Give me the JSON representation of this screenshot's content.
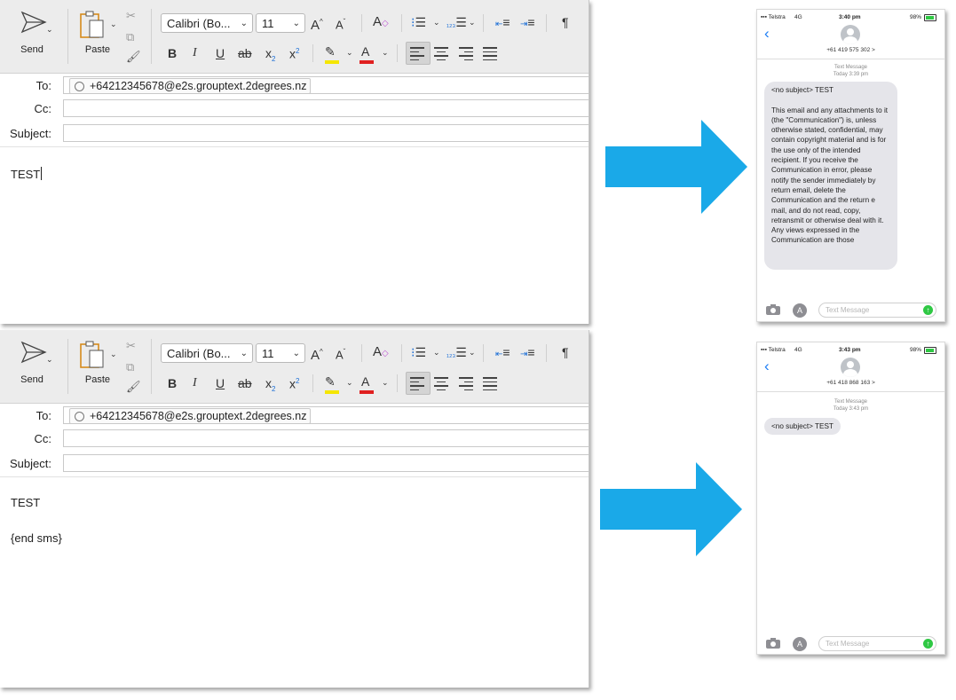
{
  "compose_windows": [
    {
      "send_label": "Send",
      "paste_label": "Paste",
      "font_name": "Calibri (Bo...",
      "font_size": "11",
      "pilcrow": "¶",
      "to_label": "To:",
      "to_recipient": "+64212345678@e2s.grouptext.2degrees.nz",
      "cc_label": "Cc:",
      "subject_label": "Subject:",
      "body_lines": [
        "TEST"
      ]
    },
    {
      "send_label": "Send",
      "paste_label": "Paste",
      "font_name": "Calibri (Bo...",
      "font_size": "11",
      "pilcrow": "¶",
      "to_label": "To:",
      "to_recipient": "+64212345678@e2s.grouptext.2degrees.nz",
      "cc_label": "Cc:",
      "subject_label": "Subject:",
      "body_lines": [
        "TEST",
        "{end sms}"
      ]
    }
  ],
  "phones": [
    {
      "carrier": "Telstra",
      "network": "4G",
      "time": "3:40 pm",
      "battery": "98%",
      "contact_number": "+61 419 575 302 >",
      "meta_label": "Text Message",
      "meta_time": "Today 3:39 pm",
      "message": "<no subject> TEST\n\nThis email and any attachments to it (the \"Communication\") is, unless otherwise stated, confidential, may contain copyright material and is for the use only of the intended recipient. If you receive the Communication in error, please notify the sender immediately by return email, delete the Communication and the return e mail, and do not read, copy, retransmit or otherwise deal with it. Any views expressed in the Communication are those",
      "input_placeholder": "Text Message"
    },
    {
      "carrier": "Telstra",
      "network": "4G",
      "time": "3:43 pm",
      "battery": "98%",
      "contact_number": "+61 418 868 163 >",
      "meta_label": "Text Message",
      "meta_time": "Today 3:43 pm",
      "message": "<no subject> TEST",
      "input_placeholder": "Text Message"
    }
  ],
  "colors": {
    "arrow": "#1aa9e8",
    "ribbon_bg": "#ececec",
    "highlight_yellow": "#f5e600",
    "font_red": "#e02020",
    "ios_blue": "#1a7cf5",
    "ios_green": "#2fc844",
    "bubble_gray": "#e5e5ea"
  }
}
